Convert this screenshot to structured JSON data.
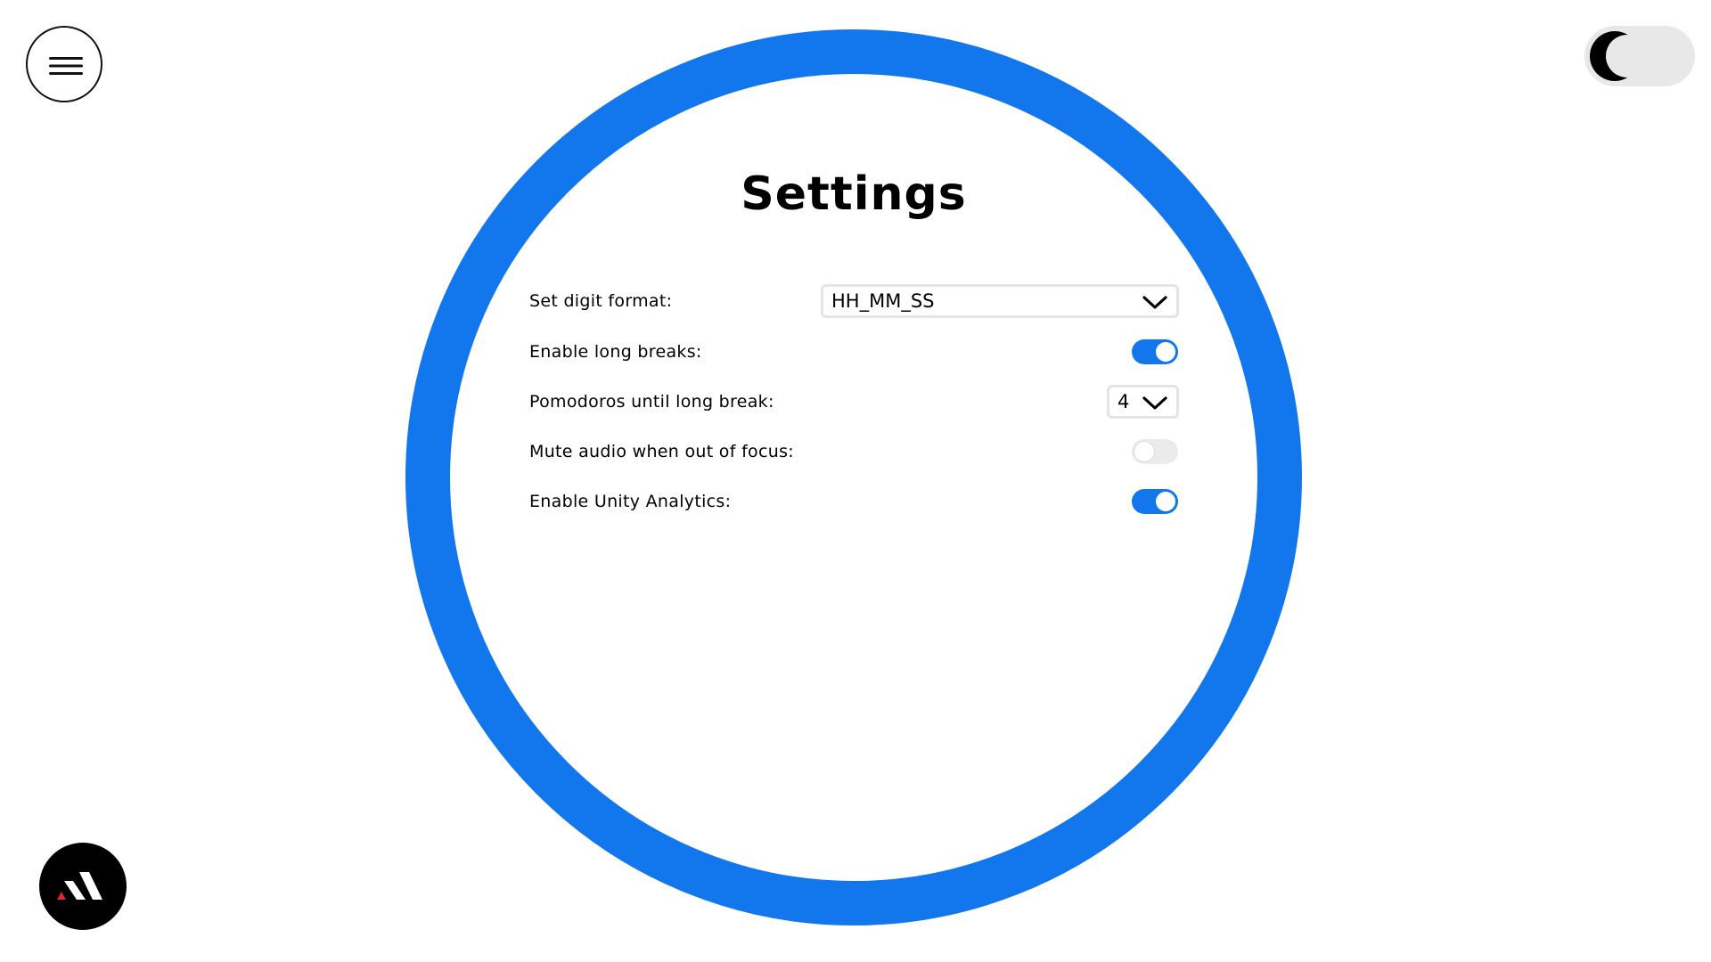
{
  "header": {
    "menu_icon": "hamburger-menu-icon",
    "theme_toggle_icon": "crescent-moon-icon"
  },
  "settings": {
    "title": "Settings",
    "digit_format": {
      "label": "Set digit format:",
      "value": "HH_MM_SS"
    },
    "long_breaks": {
      "label": "Enable long breaks:",
      "enabled": true
    },
    "pomodoros_until_long_break": {
      "label": "Pomodoros until long break:",
      "value": "4"
    },
    "mute_audio_out_of_focus": {
      "label": "Mute audio when out of focus:",
      "enabled": false
    },
    "unity_analytics": {
      "label": "Enable Unity Analytics:",
      "enabled": true
    }
  },
  "brand": {
    "logo_icon": "brand-logo-icon"
  },
  "colors": {
    "accent": "#1276ec",
    "toggle_off": "#ebebeb",
    "logo_mark_red": "#e0262b"
  }
}
